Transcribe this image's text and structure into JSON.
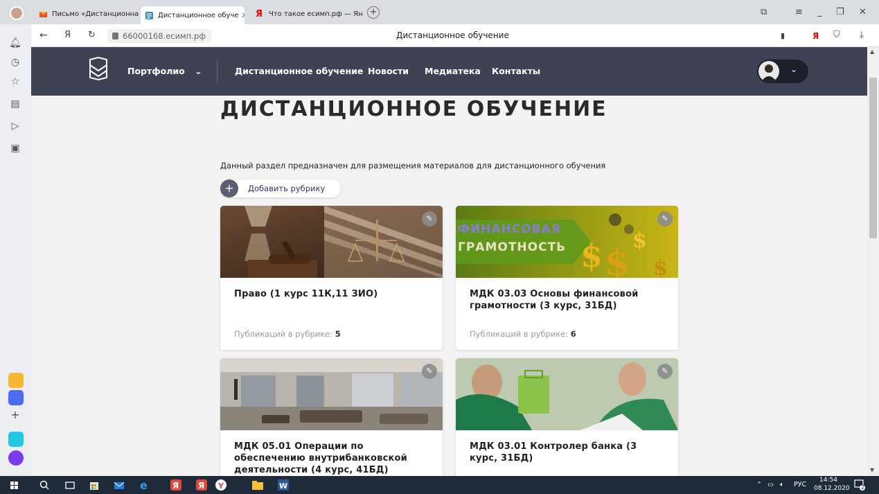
{
  "browser": {
    "tabs": [
      {
        "label": "Письмо «Дистанционная"
      },
      {
        "label": "Дистанционное обуче"
      },
      {
        "label": "Что такое есимп.рф — Ян"
      }
    ],
    "url": "66000168.есимп.рф",
    "page_title": "Дистанционное обучение"
  },
  "site": {
    "nav": [
      {
        "label": "Портфолио"
      },
      {
        "label": "Дистанционное обучение"
      },
      {
        "label": "Новости"
      },
      {
        "label": "Медиатека"
      },
      {
        "label": "Контакты"
      }
    ]
  },
  "content": {
    "heading": "ДИСТАНЦИОННОЕ ОБУЧЕНИЕ",
    "description": "Данный раздел предназначен для размещения материалов для дистанционного обучения",
    "add_label": "Добавить рубрику",
    "pubs_label": "Публикаций в рубрике:",
    "cards": [
      {
        "title": "Право (1 курс 11К,11 ЗИО)",
        "count": "5"
      },
      {
        "title": "МДК 03.03 Основы финансовой грамотности (3 курс, 31БД)",
        "count": "6",
        "banner_line1": "ФИНАНСОВАЯ",
        "banner_line2": "ГРАМОТНОСТЬ"
      },
      {
        "title": "МДК 05.01 Операции по обеспечению внутрибанковской деятельности (4 курс, 41БД)"
      },
      {
        "title": "МДК 03.01 Контролер банка (3 курс, 31БД)"
      }
    ]
  },
  "taskbar": {
    "lang": "РУС",
    "time": "14:54",
    "date": "08.12.2020",
    "notifications": "2"
  },
  "colors": {
    "header_bg": "#3f4255",
    "page_bg": "#f3f3f3",
    "taskbar_bg": "#1f2a3a"
  }
}
